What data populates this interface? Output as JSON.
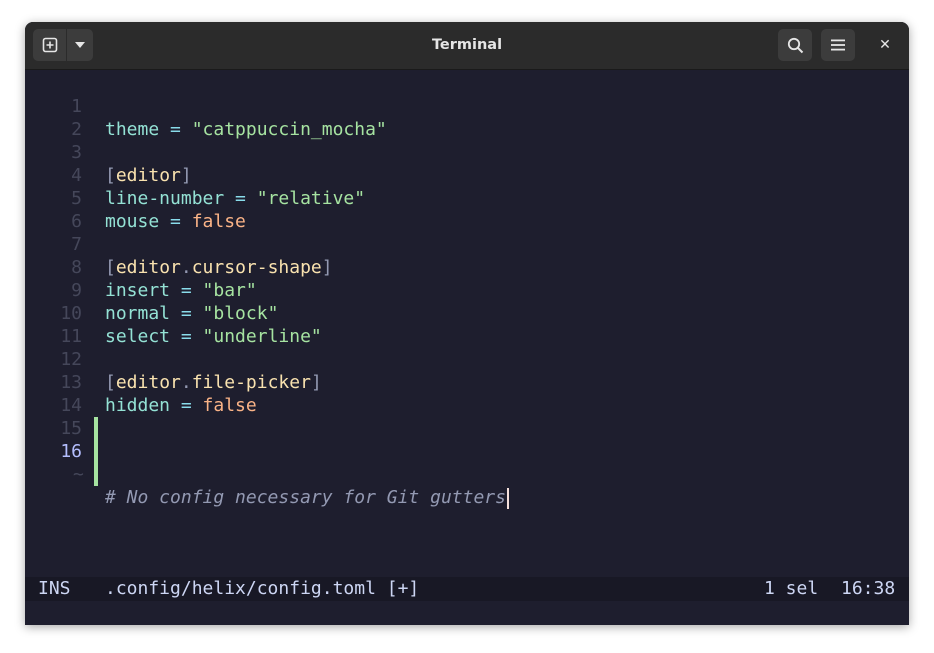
{
  "window": {
    "title": "Terminal",
    "new_tab_icon": "plus-square-icon",
    "dropdown_icon": "chevron-down-icon",
    "search_icon": "search-icon",
    "menu_icon": "hamburger-menu-icon",
    "close_label": "✕"
  },
  "editor": {
    "current_line": 16,
    "lines": [
      {
        "n": "1"
      },
      {
        "n": "2"
      },
      {
        "n": "3"
      },
      {
        "n": "4"
      },
      {
        "n": "5"
      },
      {
        "n": "6"
      },
      {
        "n": "7"
      },
      {
        "n": "8"
      },
      {
        "n": "9"
      },
      {
        "n": "10"
      },
      {
        "n": "11"
      },
      {
        "n": "12"
      },
      {
        "n": "13"
      },
      {
        "n": "14"
      },
      {
        "n": "15"
      },
      {
        "n": "16"
      }
    ],
    "code": {
      "l1_key": "theme",
      "l1_op": " = ",
      "l1_val": "\"catppuccin_mocha\"",
      "l3_open": "[",
      "l3_tbl": "editor",
      "l3_close": "]",
      "l4_key": "line-number",
      "l4_op": " = ",
      "l4_val": "\"relative\"",
      "l5_key": "mouse",
      "l5_op": " = ",
      "l5_val": "false",
      "l7_open": "[",
      "l7_tbl1": "editor",
      "l7_dot": ".",
      "l7_tbl2": "cursor-shape",
      "l7_close": "]",
      "l8_key": "insert",
      "l8_op": " = ",
      "l8_val": "\"bar\"",
      "l9_key": "normal",
      "l9_op": " = ",
      "l9_val": "\"block\"",
      "l10_key": "select",
      "l10_op": " = ",
      "l10_val": "\"underline\"",
      "l12_open": "[",
      "l12_tbl1": "editor",
      "l12_dot": ".",
      "l12_tbl2": "file-picker",
      "l12_close": "]",
      "l13_key": "hidden",
      "l13_op": " = ",
      "l13_val": "false",
      "l16_comment": "# No config necessary for Git gutters"
    },
    "tilde": "~"
  },
  "status": {
    "mode": "INS",
    "file": ".config/helix/config.toml [+]",
    "selections": "1 sel",
    "position": "16:38"
  },
  "colors": {
    "background": "#1e1e2e",
    "gutter_added": "#a6e3a1",
    "string": "#a6e3a1",
    "boolean": "#fab387",
    "key": "#94e2d5",
    "table": "#f9e2af"
  }
}
